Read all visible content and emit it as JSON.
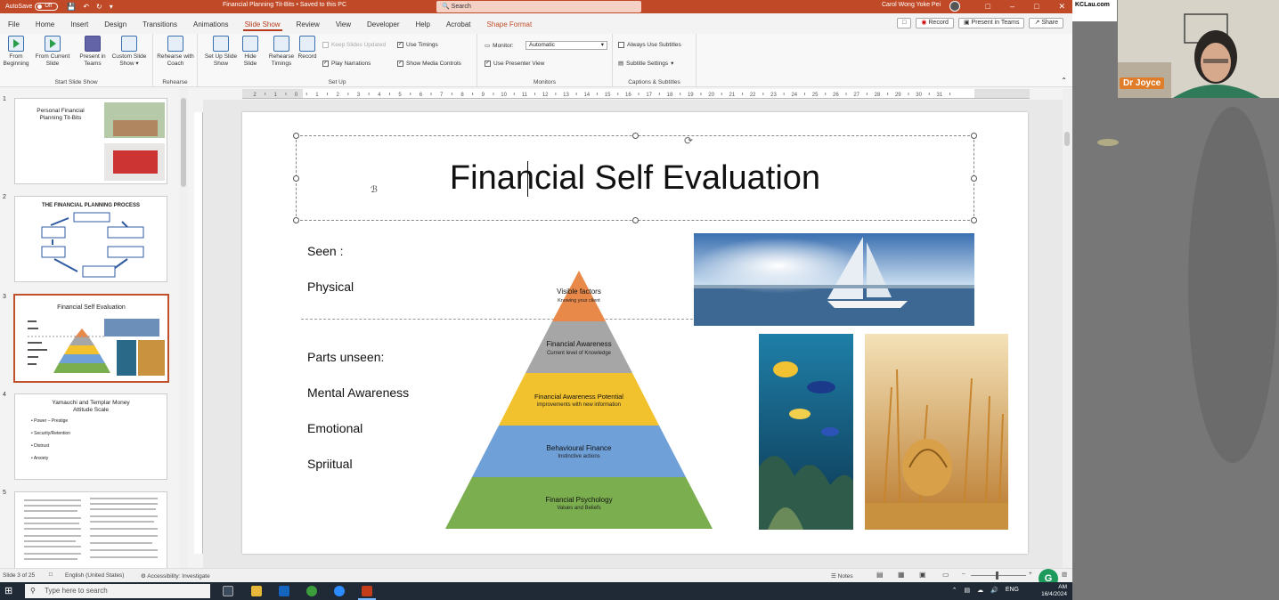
{
  "titlebar": {
    "autosave_label": "AutoSave",
    "autosave_state": "Off",
    "doc_title": "Financial Planning Tit-Bits  •  Saved to this PC",
    "search_placeholder": "Search",
    "user_name": "Carol Wong Yoke Pei"
  },
  "menu": {
    "tabs": [
      "File",
      "Home",
      "Insert",
      "Design",
      "Transitions",
      "Animations",
      "Slide Show",
      "Review",
      "View",
      "Developer",
      "Help",
      "Acrobat",
      "Shape Format"
    ],
    "active_tab": "Slide Show"
  },
  "top_right": {
    "record": "Record",
    "present_in_teams": "Present in Teams",
    "share": "Share"
  },
  "ribbon": {
    "start": {
      "group_label": "Start Slide Show",
      "from_beginning": "From Beginning",
      "from_current": "From Current Slide",
      "present_teams": "Present in Teams",
      "custom": "Custom Slide Show"
    },
    "rehearse": {
      "group_label": "Rehearse",
      "coach": "Rehearse with Coach"
    },
    "setup": {
      "group_label": "Set Up",
      "setup_show": "Set Up Slide Show",
      "hide_slide": "Hide Slide",
      "rehearse_timings": "Rehearse Timings",
      "record": "Record",
      "keep_updated": "Keep Slides Updated",
      "use_timings": "Use Timings",
      "play_narrations": "Play Narrations",
      "show_media": "Show Media Controls"
    },
    "monitors": {
      "group_label": "Monitors",
      "monitor_label": "Monitor:",
      "monitor_value": "Automatic",
      "presenter_view": "Use Presenter View"
    },
    "captions": {
      "group_label": "Captions & Subtitles",
      "always_subtitles": "Always Use Subtitles",
      "subtitle_settings": "Subtitle Settings"
    }
  },
  "thumbnails": [
    {
      "num": "1",
      "title": "Personal Financial Planning Tit-Bits"
    },
    {
      "num": "2",
      "title": "THE FINANCIAL PLANNING PROCESS"
    },
    {
      "num": "3",
      "title": "Financial Self Evaluation"
    },
    {
      "num": "4",
      "title": "Yamauchi and Templar Money Attitude Scale",
      "bullets": [
        "Power – Prestige",
        "Security/Retention",
        "Distrust",
        "Anxiety"
      ]
    },
    {
      "num": "5",
      "title": ""
    }
  ],
  "ruler": {
    "marks": [
      "2",
      "1",
      "0",
      "1",
      "2",
      "3",
      "4",
      "5",
      "6",
      "7",
      "8",
      "9",
      "10",
      "11",
      "12",
      "13",
      "14",
      "15",
      "16",
      "17",
      "18",
      "19",
      "20",
      "21",
      "22",
      "23",
      "24",
      "25",
      "26",
      "27",
      "28",
      "29",
      "30",
      "31"
    ]
  },
  "slide": {
    "title": "Financial Self Evaluation",
    "seen_label": "Seen :",
    "physical": "Physical",
    "unseen_label": "Parts unseen:",
    "mental": "Mental Awareness",
    "emotional": "Emotional",
    "spiritual": "Spriitual",
    "pyramid": [
      {
        "title": "Visible factors",
        "sub": "Knowing your client",
        "color": "#e8894a"
      },
      {
        "title": "Financial Awareness",
        "sub": "Current level of Knowledge",
        "color": "#a6a6a6"
      },
      {
        "title": "Financial Awareness Potential",
        "sub": "improvements with new information",
        "color": "#f2c12e"
      },
      {
        "title": "Behavioural Finance",
        "sub": "Instinctive actions",
        "color": "#6fa0d8"
      },
      {
        "title": "Financial Psychology",
        "sub": "Values and Beliefs",
        "color": "#7bae4f"
      }
    ]
  },
  "status": {
    "slide_info": "Slide 3 of 25",
    "language": "English (United States)",
    "accessibility": "Accessibility: Investigate",
    "notes": "Notes"
  },
  "taskbar": {
    "search_placeholder": "Type here to search",
    "lang": "ENG",
    "time": "AM",
    "date": "16/4/2024"
  },
  "video": {
    "top_label": "KCLau.com",
    "participant": "Dr Joyce"
  }
}
